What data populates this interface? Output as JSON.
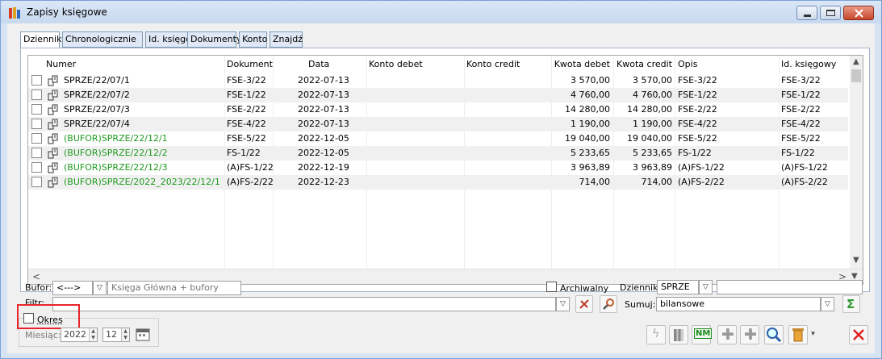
{
  "window": {
    "title": "Zapisy księgowe",
    "colors": {
      "accent": "#7aa2d6",
      "green_text": "#1e9a1e",
      "highlight": "#e8262a"
    }
  },
  "tabs": [
    {
      "label": "Dzienniki",
      "active": true
    },
    {
      "label": "Chronologicznie",
      "active": false
    },
    {
      "label": "Id. księgowy",
      "active": false
    },
    {
      "label": "Dokumenty",
      "active": false
    },
    {
      "label": "Konto",
      "active": false
    },
    {
      "label": "Znajdź",
      "active": false
    }
  ],
  "table": {
    "columns": [
      "Numer",
      "Dokument",
      "Data",
      "Konto debet",
      "Konto credit",
      "Kwota debet",
      "Kwota credit",
      "Opis",
      "Id. księgowy"
    ],
    "rows": [
      {
        "numer": "SPRZE/22/07/1",
        "dokument": "FSE-3/22",
        "data": "2022-07-13",
        "konto_debet": "",
        "konto_credit": "",
        "kwota_debet": "3 570,00",
        "kwota_credit": "3 570,00",
        "opis": "FSE-3/22",
        "id": "FSE-3/22",
        "buffer": false
      },
      {
        "numer": "SPRZE/22/07/2",
        "dokument": "FSE-1/22",
        "data": "2022-07-13",
        "konto_debet": "",
        "konto_credit": "",
        "kwota_debet": "4 760,00",
        "kwota_credit": "4 760,00",
        "opis": "FSE-1/22",
        "id": "FSE-1/22",
        "buffer": false
      },
      {
        "numer": "SPRZE/22/07/3",
        "dokument": "FSE-2/22",
        "data": "2022-07-13",
        "konto_debet": "",
        "konto_credit": "",
        "kwota_debet": "14 280,00",
        "kwota_credit": "14 280,00",
        "opis": "FSE-2/22",
        "id": "FSE-2/22",
        "buffer": false
      },
      {
        "numer": "SPRZE/22/07/4",
        "dokument": "FSE-4/22",
        "data": "2022-07-13",
        "konto_debet": "",
        "konto_credit": "",
        "kwota_debet": "1 190,00",
        "kwota_credit": "1 190,00",
        "opis": "FSE-4/22",
        "id": "FSE-4/22",
        "buffer": false
      },
      {
        "numer": "(BUFOR)SPRZE/22/12/1",
        "dokument": "FSE-5/22",
        "data": "2022-12-05",
        "konto_debet": "",
        "konto_credit": "",
        "kwota_debet": "19 040,00",
        "kwota_credit": "19 040,00",
        "opis": "FSE-5/22",
        "id": "FSE-5/22",
        "buffer": true
      },
      {
        "numer": "(BUFOR)SPRZE/22/12/2",
        "dokument": "FS-1/22",
        "data": "2022-12-05",
        "konto_debet": "",
        "konto_credit": "",
        "kwota_debet": "5 233,65",
        "kwota_credit": "5 233,65",
        "opis": "FS-1/22",
        "id": "FS-1/22",
        "buffer": true
      },
      {
        "numer": "(BUFOR)SPRZE/22/12/3",
        "dokument": "(A)FS-1/22",
        "data": "2022-12-19",
        "konto_debet": "",
        "konto_credit": "",
        "kwota_debet": "3 963,89",
        "kwota_credit": "3 963,89",
        "opis": "(A)FS-1/22",
        "id": "(A)FS-1/22",
        "buffer": true
      },
      {
        "numer": "(BUFOR)SPRZE/2022_2023/22/12/1",
        "dokument": "(A)FS-2/22",
        "data": "2022-12-23",
        "konto_debet": "",
        "konto_credit": "",
        "kwota_debet": "714,00",
        "kwota_credit": "714,00",
        "opis": "(A)FS-2/22",
        "id": "(A)FS-2/22",
        "buffer": true
      }
    ]
  },
  "filters": {
    "bufor_label": "Bufor:",
    "bufor_value": "<--->",
    "bufor_text": "Księga Główna + bufory",
    "archiwalny_label": "Archiwalny",
    "dziennik_label": "Dziennik:",
    "dziennik_value": "SPRZE",
    "filtr_label": "Filtr:",
    "sumuj_label": "Sumuj:",
    "sumuj_value": "bilansowe",
    "okres_label": "Okres",
    "miesiac_label": "Miesiąc:",
    "year": "2022",
    "month": "12"
  },
  "toolbar": {
    "icons": [
      "lightning-icon",
      "book-icon",
      "nm-icon",
      "add-plus-icon",
      "add-plus-icon",
      "magnifier-icon",
      "trash-icon",
      "close-icon"
    ]
  }
}
